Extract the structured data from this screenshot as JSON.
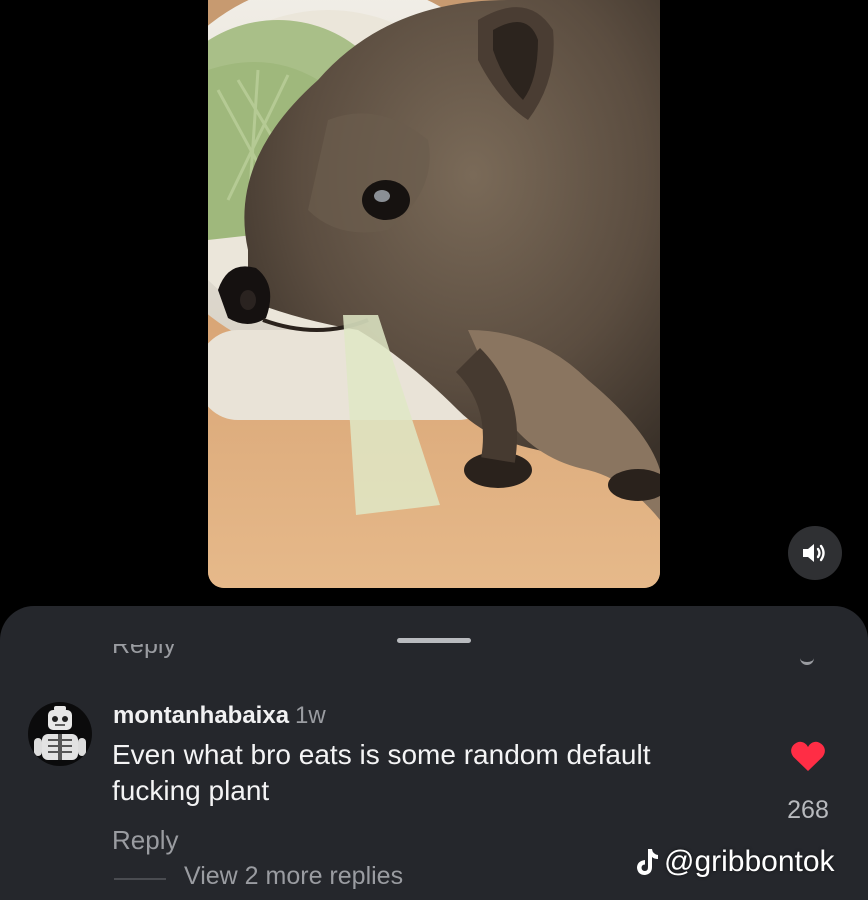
{
  "video": {
    "icon": "volume-on-icon"
  },
  "comments": {
    "truncated_above": "Reply",
    "comment": {
      "username": "montanhabaixa",
      "time_ago": "1w",
      "text": "Even what bro eats is some random default fucking plant",
      "like_count": "268",
      "liked": true,
      "like_color": "#ff2d45",
      "reply_label": "Reply",
      "view_replies_label": "View 2 more replies"
    }
  },
  "watermark": {
    "handle": "@gribbontok",
    "icon": "tiktok-logo-icon"
  },
  "colors": {
    "background": "#000000",
    "sheet": "#25272c",
    "primary_text": "#f4f4f5",
    "secondary_text": "#9a9ca1"
  }
}
